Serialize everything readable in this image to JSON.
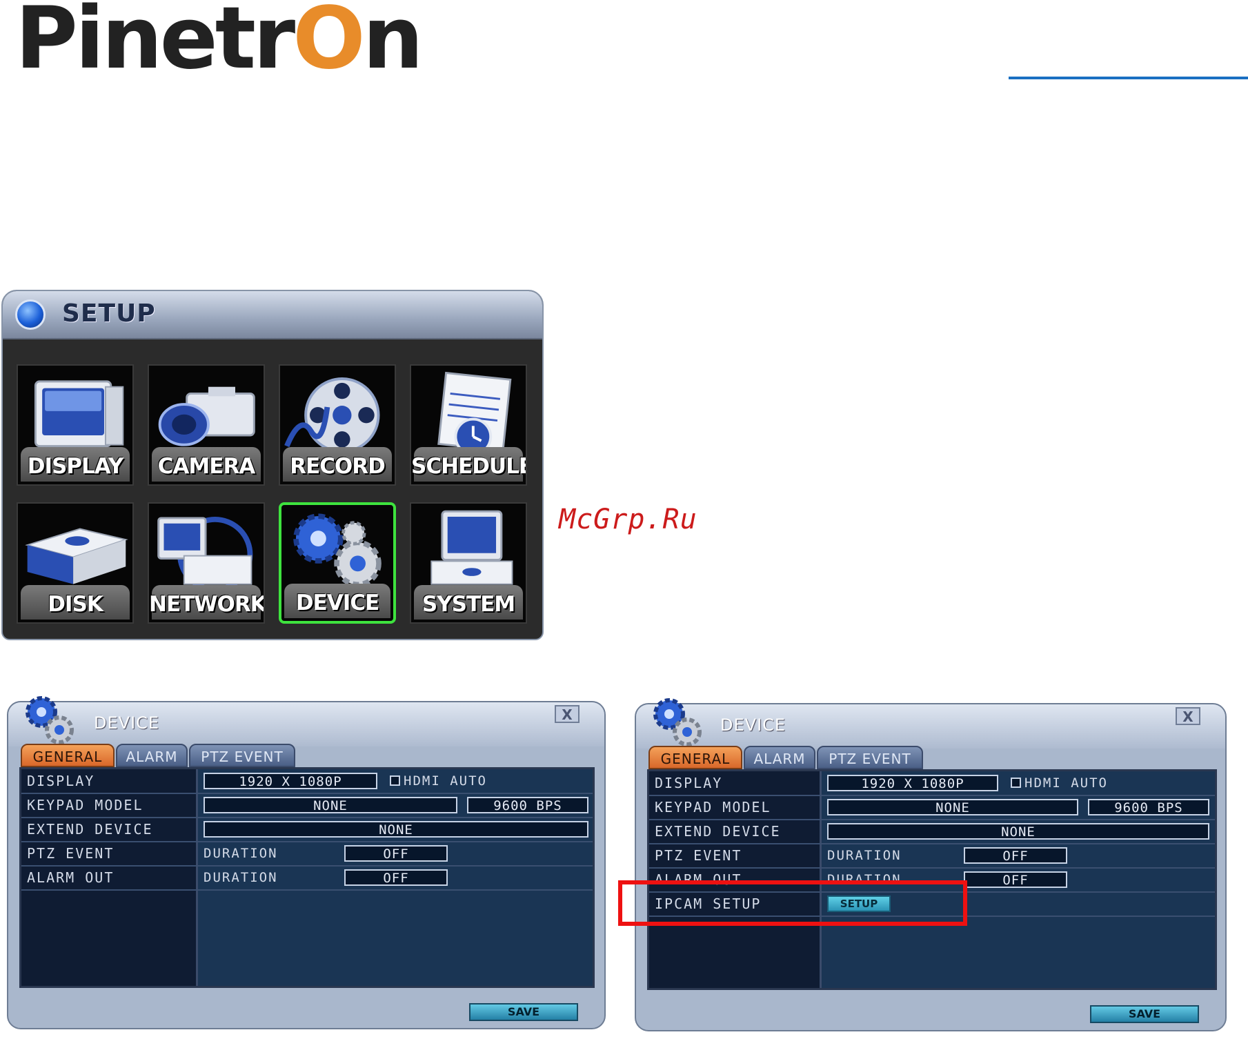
{
  "logo": {
    "text_before": "Pinetr",
    "text_o": "O",
    "text_after": "n"
  },
  "watermark": "McGrp.Ru",
  "setup": {
    "title": "SETUP",
    "tiles": [
      {
        "label": "DISPLAY",
        "icon": "monitor-icon"
      },
      {
        "label": "CAMERA",
        "icon": "camera-icon"
      },
      {
        "label": "RECORD",
        "icon": "film-reel-icon"
      },
      {
        "label": "SCHEDULE",
        "icon": "calendar-clock-icon"
      },
      {
        "label": "DISK",
        "icon": "hard-disk-icon"
      },
      {
        "label": "NETWORK",
        "icon": "network-icon"
      },
      {
        "label": "DEVICE",
        "icon": "gears-icon",
        "selected": true
      },
      {
        "label": "SYSTEM",
        "icon": "computer-icon"
      }
    ]
  },
  "device_left": {
    "title": "DEVICE",
    "close": "X",
    "tabs": [
      "GENERAL",
      "ALARM",
      "PTZ EVENT"
    ],
    "rows": {
      "display": {
        "label": "DISPLAY",
        "resolution": "1920 X 1080P",
        "hdmi_auto": "HDMI AUTO"
      },
      "keypad": {
        "label": "KEYPAD MODEL",
        "model": "NONE",
        "baud": "9600 BPS"
      },
      "extend": {
        "label": "EXTEND DEVICE",
        "value": "NONE"
      },
      "ptz": {
        "label": "PTZ EVENT",
        "duration_label": "DURATION",
        "value": "OFF"
      },
      "alarm": {
        "label": "ALARM OUT",
        "duration_label": "DURATION",
        "value": "OFF"
      }
    },
    "save": "SAVE"
  },
  "device_right": {
    "title": "DEVICE",
    "close": "X",
    "tabs": [
      "GENERAL",
      "ALARM",
      "PTZ EVENT"
    ],
    "rows": {
      "display": {
        "label": "DISPLAY",
        "resolution": "1920 X 1080P",
        "hdmi_auto": "HDMI AUTO"
      },
      "keypad": {
        "label": "KEYPAD MODEL",
        "model": "NONE",
        "baud": "9600 BPS"
      },
      "extend": {
        "label": "EXTEND DEVICE",
        "value": "NONE"
      },
      "ptz": {
        "label": "PTZ EVENT",
        "duration_label": "DURATION",
        "value": "OFF"
      },
      "alarm": {
        "label": "ALARM OUT",
        "duration_label": "DURATION",
        "value": "OFF"
      },
      "ipcam": {
        "label": "IPCAM SETUP",
        "button": "SETUP"
      }
    },
    "save": "SAVE"
  },
  "colors": {
    "accent_blue": "#1a6fc2",
    "logo_orange": "#e88c2a",
    "highlight_red": "#ee1111",
    "selected_green": "#3ee33e"
  }
}
